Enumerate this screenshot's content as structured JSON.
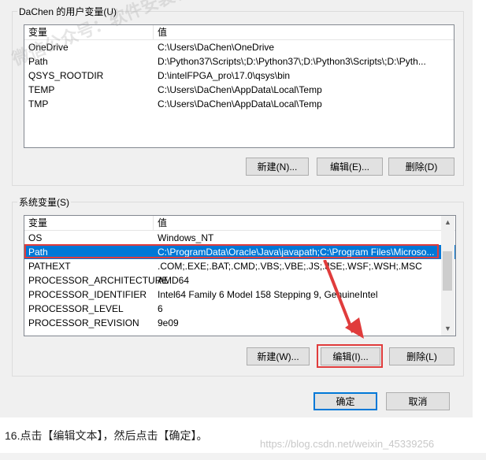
{
  "user_vars": {
    "group_title": "DaChen 的用户变量(U)",
    "col_var": "变量",
    "col_val": "值",
    "rows": [
      {
        "name": "OneDrive",
        "value": "C:\\Users\\DaChen\\OneDrive"
      },
      {
        "name": "Path",
        "value": "D:\\Python37\\Scripts\\;D:\\Python37\\;D:\\Python3\\Scripts\\;D:\\Pyth..."
      },
      {
        "name": "QSYS_ROOTDIR",
        "value": "D:\\intelFPGA_pro\\17.0\\qsys\\bin"
      },
      {
        "name": "TEMP",
        "value": "C:\\Users\\DaChen\\AppData\\Local\\Temp"
      },
      {
        "name": "TMP",
        "value": "C:\\Users\\DaChen\\AppData\\Local\\Temp"
      }
    ],
    "new_button": "新建(N)...",
    "edit_button": "编辑(E)...",
    "delete_button": "删除(D)"
  },
  "system_vars": {
    "group_title": "系统变量(S)",
    "col_var": "变量",
    "col_val": "值",
    "rows": [
      {
        "name": "OS",
        "value": "Windows_NT"
      },
      {
        "name": "Path",
        "value": "C:\\ProgramData\\Oracle\\Java\\javapath;C:\\Program Files\\Microso..."
      },
      {
        "name": "PATHEXT",
        "value": ".COM;.EXE;.BAT;.CMD;.VBS;.VBE;.JS;.JSE;.WSF;.WSH;.MSC"
      },
      {
        "name": "PROCESSOR_ARCHITECTURE",
        "value": "AMD64"
      },
      {
        "name": "PROCESSOR_IDENTIFIER",
        "value": "Intel64 Family 6 Model 158 Stepping 9, GenuineIntel"
      },
      {
        "name": "PROCESSOR_LEVEL",
        "value": "6"
      },
      {
        "name": "PROCESSOR_REVISION",
        "value": "9e09"
      }
    ],
    "selected_row": "Path",
    "new_button": "新建(W)...",
    "edit_button": "编辑(I)...",
    "delete_button": "删除(L)"
  },
  "dialog_buttons": {
    "ok": "确定",
    "cancel": "取消"
  },
  "caption": "16.点击【编辑文本】，然后点击【确定】。",
  "watermark_text": "微信公众号：软件安装管家",
  "watermark_url": "https://blog.csdn.net/weixin_45339256",
  "colors": {
    "selection": "#0078d7",
    "highlight_box": "#e03c3c",
    "arrow": "#e03c3c"
  }
}
